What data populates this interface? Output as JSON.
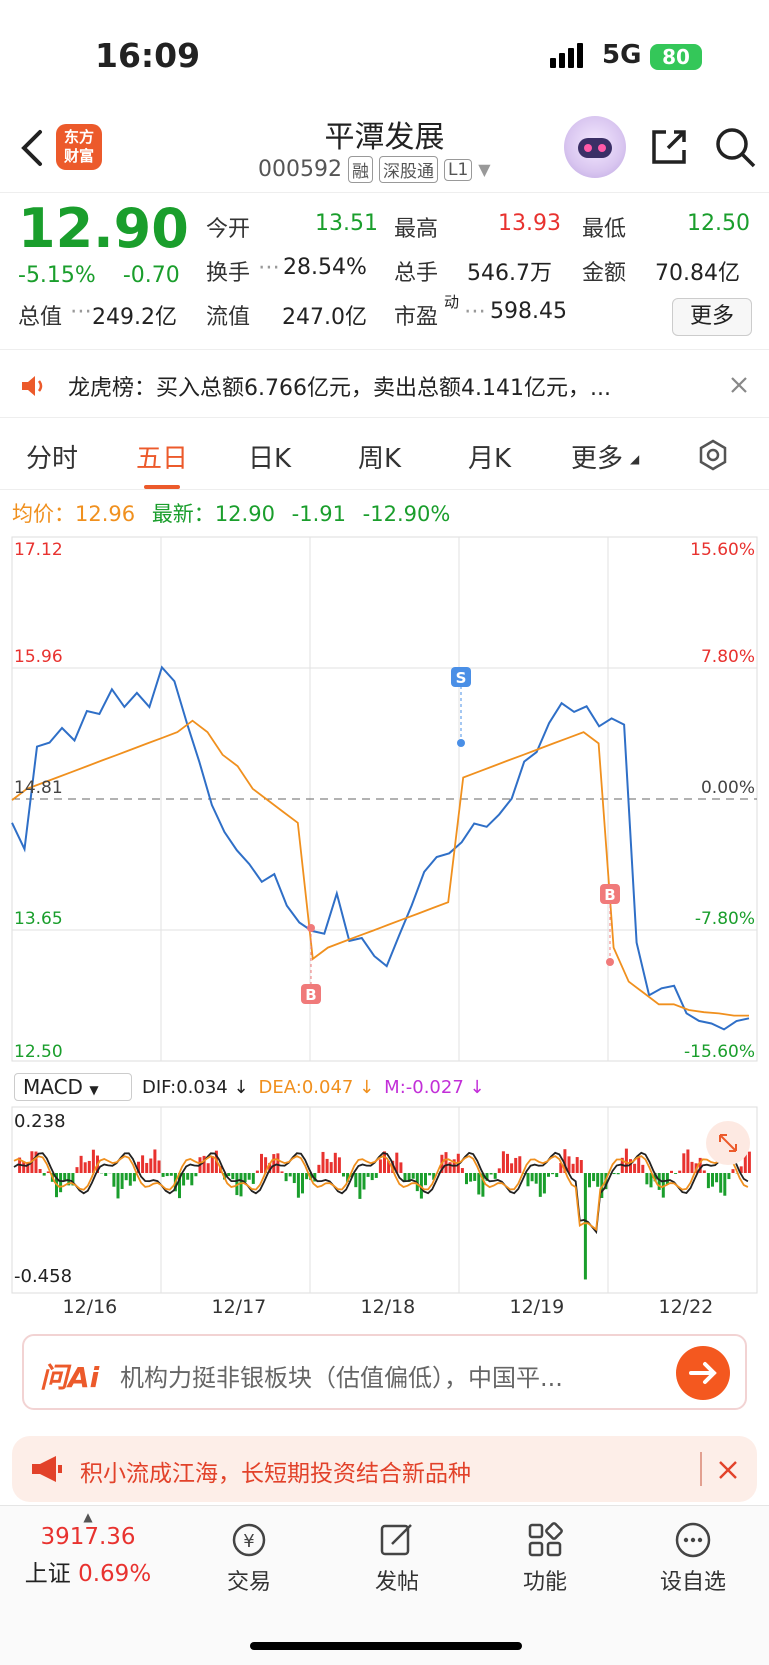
{
  "status": {
    "time": "16:09",
    "network": "5G",
    "battery": "80"
  },
  "header": {
    "stock_name": "平潭发展",
    "code": "000592",
    "tags": [
      "融",
      "深股通",
      "L1"
    ],
    "logo_text": [
      "东方",
      "财富"
    ]
  },
  "quote": {
    "price": "12.90",
    "change_pct": "-5.15%",
    "change": "-0.70",
    "open_label": "今开",
    "open": "13.51",
    "high_label": "最高",
    "high": "13.93",
    "low_label": "最低",
    "low": "12.50",
    "turnover_label": "换手",
    "turnover": "28.54%",
    "volume_label": "总手",
    "volume": "546.7万",
    "amount_label": "金额",
    "amount": "70.84亿",
    "mktcap_label": "总值",
    "mktcap": "249.2亿",
    "float_label": "流值",
    "float": "247.0亿",
    "pe_label": "市盈",
    "pe_sup": "动",
    "pe": "598.45",
    "more": "更多"
  },
  "ticker": {
    "text": "龙虎榜：买入总额6.766亿元，卖出总额4.141亿元，..."
  },
  "tabs": [
    "分时",
    "五日",
    "日K",
    "周K",
    "月K",
    "更多"
  ],
  "avg": {
    "avg_label": "均价：",
    "avg": "12.96",
    "latest_label": "最新：",
    "latest": "12.90",
    "chg": "-1.91",
    "pct": "-12.90%"
  },
  "chart_data": {
    "type": "line",
    "title": "",
    "y_left_ticks": [
      "17.12",
      "15.96",
      "14.81",
      "13.65",
      "12.50"
    ],
    "y_right_ticks": [
      "15.60%",
      "7.80%",
      "0.00%",
      "-7.80%",
      "-15.60%"
    ],
    "ylim": [
      12.5,
      17.12
    ],
    "x_days": [
      "12/16",
      "12/17",
      "12/18",
      "12/19",
      "12/22"
    ],
    "markers": [
      {
        "label": "B",
        "day": "12/17"
      },
      {
        "label": "S",
        "day": "12/18"
      },
      {
        "label": "B",
        "day": "12/19"
      }
    ],
    "series": [
      {
        "values": [
          14.6,
          14.3,
          15.2,
          15.3,
          15.5,
          15.4,
          15.6,
          15.5,
          15.7,
          15.6,
          15.8,
          15.7,
          16.0,
          15.8,
          15.4,
          15.1,
          14.8,
          14.6,
          14.4,
          14.2,
          14.0,
          14.1,
          13.9,
          13.8,
          13.7,
          13.6,
          13.9,
          13.5,
          13.6,
          13.5,
          13.4,
          13.6,
          13.8,
          14.1,
          14.3,
          14.4,
          14.5,
          14.6,
          14.5,
          14.6,
          14.8,
          15.2,
          15.3,
          15.5,
          15.6,
          15.5,
          15.6,
          15.5,
          15.6,
          15.5,
          13.5,
          13.0,
          13.1,
          13.2,
          13.0,
          12.9,
          12.8,
          12.7,
          12.8,
          12.9
        ],
        "color": "#2f6fc7"
      },
      {
        "values": [
          14.8,
          14.9,
          14.95,
          15.0,
          15.05,
          15.1,
          15.15,
          15.2,
          15.25,
          15.3,
          15.35,
          15.4,
          15.5,
          15.4,
          15.2,
          15.1,
          14.9,
          14.8,
          14.7,
          14.6,
          13.4,
          13.5,
          13.55,
          13.6,
          13.65,
          13.7,
          13.75,
          13.8,
          13.85,
          13.9,
          15.0,
          15.05,
          15.1,
          15.15,
          15.2,
          15.25,
          15.3,
          15.35,
          15.4,
          15.3,
          13.5,
          13.2,
          13.1,
          13.0,
          13.0,
          12.95,
          12.93,
          12.92,
          12.9,
          12.9
        ],
        "color": "#f0901e"
      }
    ]
  },
  "macd": {
    "label": "MACD",
    "dif": "DIF:0.034 ↓",
    "dea": "DEA:0.047 ↓",
    "m": "M:-0.027 ↓",
    "top": "0.238",
    "bottom": "-0.458"
  },
  "ai": {
    "logo": "问Ai",
    "text": "机构力挺非银板块（估值偏低），中国平..."
  },
  "promo": {
    "text": "积小流成江海，长短期投资结合新品种"
  },
  "bottom": {
    "index_value": "3917.36",
    "index_name": "上证",
    "index_pct": "0.69%",
    "items": [
      "交易",
      "发帖",
      "功能",
      "设自选"
    ]
  },
  "colors": {
    "up": "#e8322f",
    "down": "#1a9e2c",
    "accent": "#ec5a2b",
    "price_line": "#2f6fc7",
    "avg_line": "#f0901e"
  }
}
